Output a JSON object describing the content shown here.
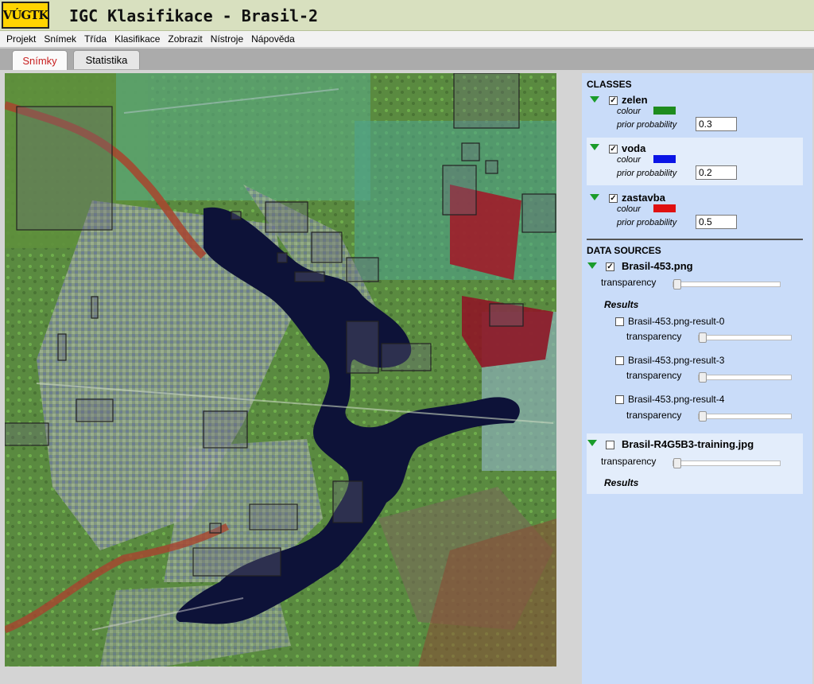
{
  "app": {
    "logo_text": "VÚGTK",
    "title": "IGC Klasifikace - Brasil-2"
  },
  "menu": [
    "Projekt",
    "Snímek",
    "Třída",
    "Klasifikace",
    "Zobrazit",
    "Nístroje",
    "Nápověda"
  ],
  "tabs": [
    {
      "label": "Snímky",
      "active": true
    },
    {
      "label": "Statistika",
      "active": false
    }
  ],
  "classes": {
    "title": "CLASSES",
    "colour_label": "colour",
    "prior_label": "prior probability",
    "items": [
      {
        "name": "zelen",
        "checked": true,
        "color": "#1e8c1e",
        "prior": "0.3"
      },
      {
        "name": "voda",
        "checked": true,
        "color": "#0a14e6",
        "prior": "0.2"
      },
      {
        "name": "zastavba",
        "checked": true,
        "color": "#e01010",
        "prior": "0.5"
      }
    ]
  },
  "data_sources": {
    "title": "DATA SOURCES",
    "transparency_label": "transparency",
    "results_label": "Results",
    "items": [
      {
        "name": "Brasil-453.png",
        "checked": true,
        "results": [
          {
            "name": "Brasil-453.png-result-0",
            "checked": false
          },
          {
            "name": "Brasil-453.png-result-3",
            "checked": false
          },
          {
            "name": "Brasil-453.png-result-4",
            "checked": false
          }
        ]
      },
      {
        "name": "Brasil-R4G5B3-training.jpg",
        "checked": false,
        "results": []
      }
    ]
  },
  "colors": {
    "panel_bg": "#c9dcf9",
    "title_bar_bg": "#d8e0bf",
    "active_tab_text": "#c81e1e",
    "lake": "#0d1238",
    "tree_triangle": "#1a9c2a"
  }
}
